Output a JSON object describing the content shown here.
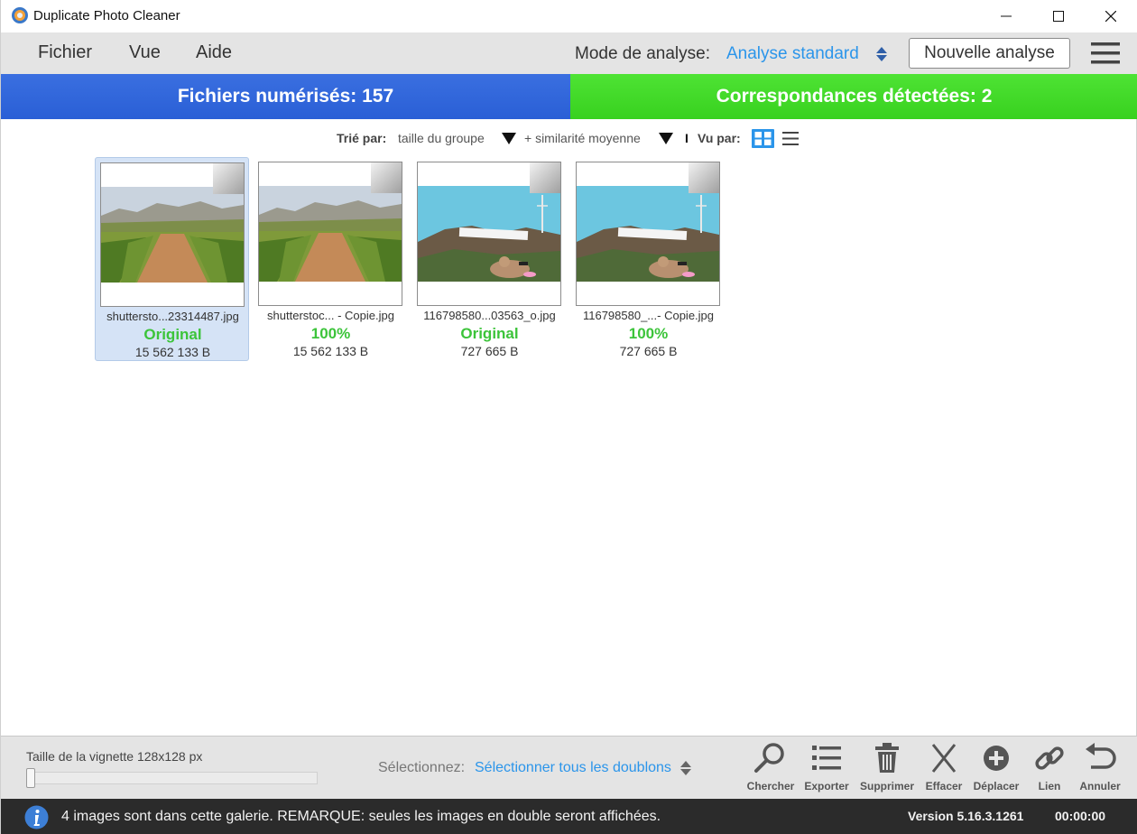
{
  "window": {
    "title": "Duplicate Photo Cleaner"
  },
  "menu": {
    "items": [
      {
        "label": "Fichier"
      },
      {
        "label": "Vue"
      },
      {
        "label": "Aide"
      }
    ],
    "mode_label": "Mode de analyse:",
    "mode_value": "Analyse standard",
    "new_scan_label": "Nouvelle analyse"
  },
  "stats": {
    "scanned": "Fichiers numérisés: 157",
    "matches": "Correspondances détectées: 2",
    "scanned_color": "#2f63da",
    "matches_color": "#44dc2a"
  },
  "sort": {
    "label": "Trié par:",
    "primary": "taille du groupe",
    "secondary": "+ similarité moyenne",
    "separator": "I",
    "view_label": "Vu par:"
  },
  "gallery": {
    "items": [
      {
        "filename": "shuttersto...23314487.jpg",
        "status": "Original",
        "size": "15 562 133 B",
        "image": "vineyard",
        "selected": true
      },
      {
        "filename": "shutterstoc... - Copie.jpg",
        "status": "100%",
        "size": "15 562 133 B",
        "image": "vineyard",
        "selected": false
      },
      {
        "filename": "116798580...03563_o.jpg",
        "status": "Original",
        "size": "727 665 B",
        "image": "hollywood",
        "selected": false
      },
      {
        "filename": "116798580_...- Copie.jpg",
        "status": "100%",
        "size": "727 665 B",
        "image": "hollywood",
        "selected": false
      }
    ]
  },
  "bottom": {
    "thumb_size_label": "Taille de la vignette 128x128 px",
    "thumb_size_value": 128,
    "select_label": "Sélectionnez:",
    "select_value": "Sélectionner tous les doublons",
    "tools": [
      {
        "label": "Chercher",
        "icon": "search-icon"
      },
      {
        "label": "Exporter",
        "icon": "list-icon"
      },
      {
        "label": "Supprimer",
        "icon": "trash-icon"
      },
      {
        "label": "Effacer",
        "icon": "x-icon"
      },
      {
        "label": "Déplacer",
        "icon": "plus-circle-icon"
      },
      {
        "label": "Lien",
        "icon": "link-icon"
      },
      {
        "label": "Annuler",
        "icon": "undo-icon"
      }
    ]
  },
  "statusbar": {
    "message": "4 images sont dans cette galerie. REMARQUE: seules les images en double seront affichées.",
    "version": "Version 5.16.3.1261",
    "timer": "00:00:00"
  }
}
